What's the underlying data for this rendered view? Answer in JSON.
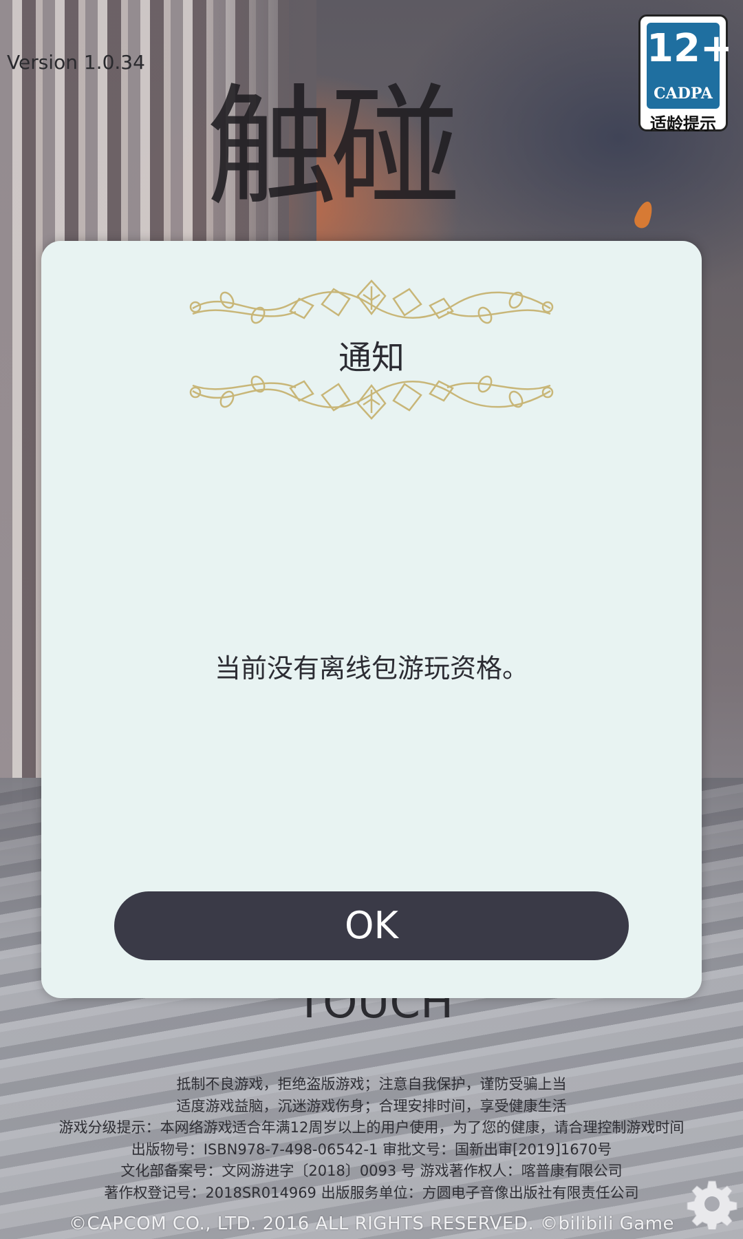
{
  "app": {
    "version_text": "Version 1.0.34",
    "logo_title": "触碰",
    "logo_subtitle": "TOUCH"
  },
  "age_rating": {
    "age": "12+",
    "org": "CADPA",
    "label": "适龄提示"
  },
  "dialog": {
    "title": "通知",
    "message": "当前没有离线包游玩资格。",
    "ok_label": "OK"
  },
  "legal": {
    "lines": [
      "抵制不良游戏，拒绝盗版游戏；注意自我保护，谨防受骗上当",
      "适度游戏益脑，沉迷游戏伤身；合理安排时间，享受健康生活",
      "游戏分级提示：本网络游戏适合年满12周岁以上的用户使用，为了您的健康，请合理控制游戏时间",
      "出版物号：ISBN978-7-498-06542-1    审批文号：国新出审[2019]1670号",
      "文化部备案号：文网游进字〔2018〕0093 号    游戏著作权人：喀普康有限公司",
      "著作权登记号：2018SR014969    出版服务单位：方圆电子音像出版社有限责任公司"
    ],
    "copyright": "©CAPCOM CO., LTD. 2016 ALL RIGHTS RESERVED. ©bilibili Game"
  },
  "icons": {
    "settings": "gear-icon"
  },
  "colors": {
    "dialog_bg": "#e8f3f2",
    "ok_button_bg": "#3a3a47",
    "ornament": "#c8b678",
    "age_badge_blue": "#1f6fa0"
  }
}
